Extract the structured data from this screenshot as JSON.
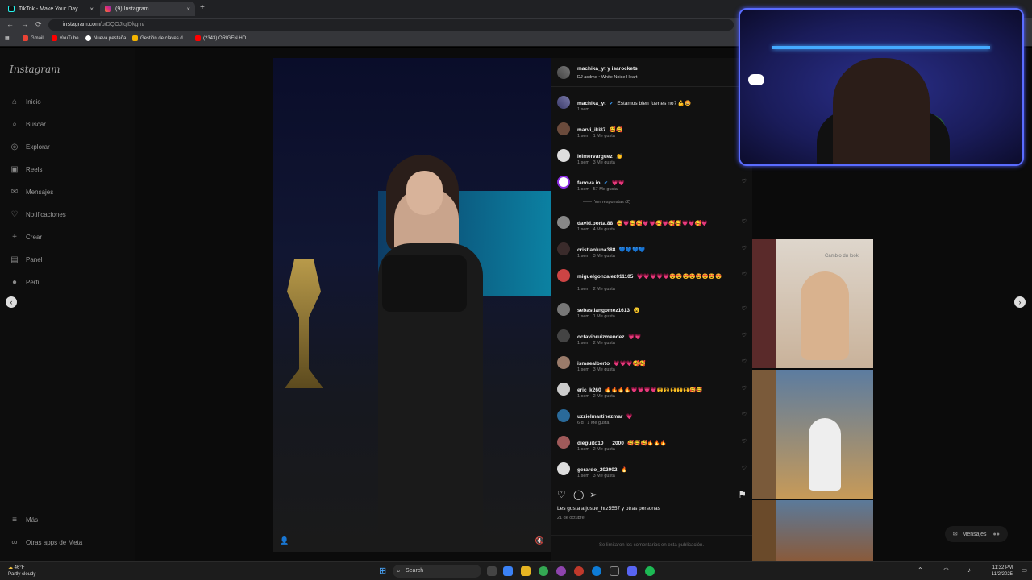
{
  "colors": {
    "instagram_bg": "#0b0b0b",
    "panel_bg": "#111111",
    "accent_blue": "#4a5aff",
    "badge_red": "#e0245e"
  },
  "browser": {
    "tabs": [
      {
        "title": "TikTok - Make Your Day",
        "active": false
      },
      {
        "title": "(9) Instagram",
        "active": true
      }
    ],
    "url_domain": "instagram.com",
    "url_path": "/p/DQOJIqIDkgm/",
    "bookmarks": [
      "Gmail",
      "YouTube",
      "Nueva pestaña",
      "Gestión de claves d...",
      "(2343) ORIGEN HO..."
    ]
  },
  "sidebar": {
    "logo": "Instagram",
    "items": [
      {
        "label": "Inicio",
        "icon": "home-icon"
      },
      {
        "label": "Buscar",
        "icon": "search-icon"
      },
      {
        "label": "Explorar",
        "icon": "compass-icon"
      },
      {
        "label": "Reels",
        "icon": "reels-icon"
      },
      {
        "label": "Mensajes",
        "icon": "messenger-icon"
      },
      {
        "label": "Notificaciones",
        "icon": "heart-icon"
      },
      {
        "label": "Crear",
        "icon": "plus-icon"
      },
      {
        "label": "Panel",
        "icon": "dashboard-icon"
      },
      {
        "label": "Perfil",
        "icon": "profile-icon"
      }
    ],
    "bottom": [
      {
        "label": "Más",
        "icon": "menu-icon"
      },
      {
        "label": "Otras apps de Meta",
        "icon": "meta-icon"
      }
    ]
  },
  "post": {
    "author": "machika_yt y isarockets",
    "audio": "DJ acdme • White Noise Heart",
    "caption_user": "machika_yt",
    "caption_text": "Estamos bien fuertes no? 💪🤩",
    "caption_time": "1 sem",
    "comments": [
      {
        "user": "marvi_iki87",
        "text": "🥰🥰",
        "time": "1 sem",
        "likes": "1 Me gusta"
      },
      {
        "user": "ielmervarguez",
        "text": "👏",
        "time": "1 sem",
        "likes": "3 Me gusta"
      },
      {
        "user": "fanova.io",
        "text": "💗💗",
        "time": "1 sem",
        "likes": "57 Me gusta",
        "replies": "Ver respuestas (2)"
      },
      {
        "user": "david.porta.88",
        "text": "🥰💗🥰🥰💗💗🥰💗🥰🥰💗💗🥰💗",
        "time": "1 sem",
        "likes": "4 Me gusta"
      },
      {
        "user": "cristianluna388",
        "text": "💙💙💙💙",
        "time": "1 sem",
        "likes": "3 Me gusta"
      },
      {
        "user": "miguelgonzalez011105",
        "text": "💗💗💗💗💗😍😍😍😍😍😍😍😍",
        "time": "1 sem",
        "likes": "2 Me gusta"
      },
      {
        "user": "sebastiangomez1613",
        "text": "😮",
        "time": "1 sem",
        "likes": "1 Me gusta"
      },
      {
        "user": "octavioruizmendez",
        "text": "💗💗",
        "time": "1 sem",
        "likes": "2 Me gusta"
      },
      {
        "user": "ismaealberto",
        "text": "💗💗💗🥰🥰",
        "time": "1 sem",
        "likes": "3 Me gusta"
      },
      {
        "user": "eric_k260",
        "text": "🔥🔥🔥🔥💗💗💗💗🙌🙌🙌🙌🙌🥰🥰",
        "time": "1 sem",
        "likes": "2 Me gusta"
      },
      {
        "user": "uzzielmartinezmar",
        "text": "💗",
        "time": "6 d",
        "likes": "1 Me gusta"
      },
      {
        "user": "dieguito10___2000",
        "text": "🥰🥰🥰🔥🔥🔥",
        "time": "1 sem",
        "likes": "2 Me gusta"
      },
      {
        "user": "gerardo_202002",
        "text": "🔥",
        "time": "1 sem",
        "likes": "3 Me gusta"
      }
    ],
    "liked_by": "Les gusta a josue_hrz5557 y otras personas",
    "date": "21 de octubre",
    "comments_limited": "Se limitaron los comentarios en esta publicación."
  },
  "right": {
    "thumb_label": "Cambio du look",
    "messages_label": "Mensajes"
  },
  "taskbar": {
    "temp": "46°F",
    "weather": "Partly cloudy",
    "search": "Search",
    "time": "11:32 PM",
    "date": "11/2/2025"
  }
}
